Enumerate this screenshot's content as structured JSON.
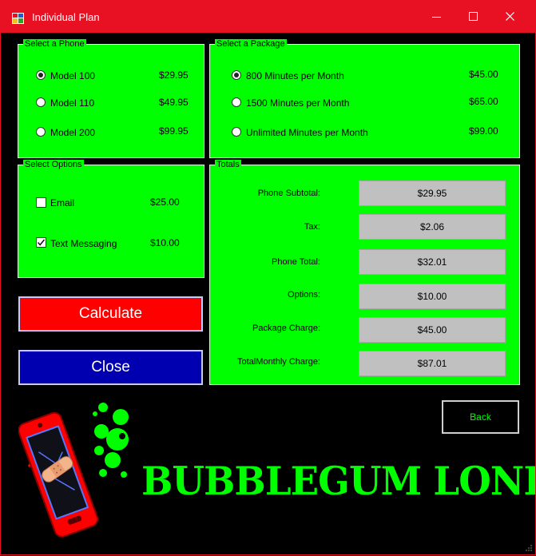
{
  "window": {
    "title": "Individual Plan"
  },
  "phone_group": {
    "legend": "Select a Phone",
    "options": [
      {
        "label": "Model 100",
        "price": "$29.95",
        "selected": true
      },
      {
        "label": "Model 110",
        "price": "$49.95",
        "selected": false
      },
      {
        "label": "Model 200",
        "price": "$99.95",
        "selected": false
      }
    ]
  },
  "package_group": {
    "legend": "Select a Package",
    "options": [
      {
        "label": "800 Minutes per Month",
        "price": "$45.00",
        "selected": true
      },
      {
        "label": "1500 Minutes per Month",
        "price": "$65.00",
        "selected": false
      },
      {
        "label": "Unlimited Minutes per Month",
        "price": "$99.00",
        "selected": false
      }
    ]
  },
  "options_group": {
    "legend": "Select Options",
    "items": [
      {
        "label": "Email",
        "price": "$25.00",
        "checked": false
      },
      {
        "label": "Text Messaging",
        "price": "$10.00",
        "checked": true
      }
    ]
  },
  "totals_group": {
    "legend": "Totals",
    "rows": [
      {
        "label": "Phone Subtotal:",
        "value": "$29.95"
      },
      {
        "label": "Tax:",
        "value": "$2.06"
      },
      {
        "label": "Phone Total:",
        "value": "$32.01"
      },
      {
        "label": "Options:",
        "value": "$10.00"
      },
      {
        "label": "Package Charge:",
        "value": "$45.00"
      },
      {
        "label": "TotalMonthly Charge:",
        "value": "$87.01"
      }
    ]
  },
  "buttons": {
    "calculate": "Calculate",
    "close": "Close",
    "back": "Back"
  },
  "logo": {
    "text": "BUBBLEGUM LONELY"
  },
  "colors": {
    "titlebar": "#e81123",
    "panel": "#00ff00",
    "calculate": "#ff0000",
    "close": "#0000b0",
    "value_box": "#c0c0c0",
    "background": "#000000"
  }
}
